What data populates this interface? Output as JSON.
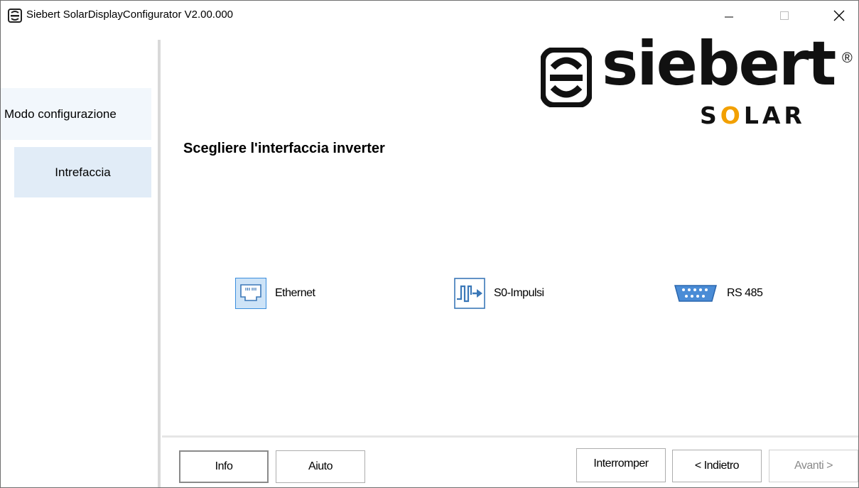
{
  "window": {
    "title": "Siebert SolarDisplayConfigurator V2.00.000",
    "controls": {
      "minimize": "minimize-icon",
      "maximize": "maximize-icon",
      "close": "close-icon"
    }
  },
  "sidebar": {
    "items": [
      {
        "label": "Modo configurazione",
        "state": "normal"
      },
      {
        "label": "Intrefaccia",
        "state": "selected"
      }
    ]
  },
  "logo": {
    "word": "siebert",
    "registered": "®",
    "solar_prefix": "S",
    "solar_sun": "O",
    "solar_suffix": "LAR"
  },
  "main": {
    "heading": "Scegliere l'interfaccia inverter",
    "options": [
      {
        "label": "Ethernet",
        "icon": "ethernet-port-icon",
        "selected": true
      },
      {
        "label": "S0-Impulsi",
        "icon": "pulse-signal-icon",
        "selected": false
      },
      {
        "label": "RS 485",
        "icon": "serial-port-icon",
        "selected": false
      }
    ]
  },
  "buttons": {
    "info": "Info",
    "help": "Aiuto",
    "cancel": "Interromper",
    "back": "< Indietro",
    "next": "Avanti >",
    "next_enabled": false
  },
  "colors": {
    "selected_option_bg": "#cde3f7",
    "selected_option_border": "#3b8ede",
    "nav_selected_bg": "#e1ecf7",
    "nav_hover_bg": "#f2f7fc",
    "logo_sun": "#f2a000"
  }
}
